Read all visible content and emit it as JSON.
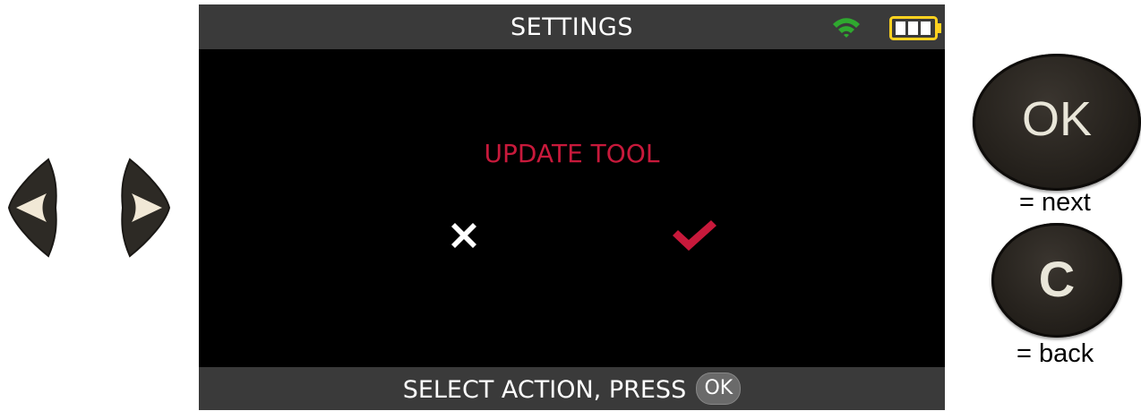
{
  "screen": {
    "title": "SETTINGS",
    "status_icons": [
      "wifi-icon",
      "battery-icon"
    ],
    "prompt": "UPDATE TOOL",
    "choices": [
      {
        "icon": "cross-icon",
        "state": "unselected",
        "color": "#ffffff"
      },
      {
        "icon": "check-icon",
        "state": "selected",
        "color": "#c8193b"
      }
    ],
    "footer_hint": "SELECT ACTION, PRESS",
    "footer_ok": "OK"
  },
  "keys": {
    "left_arrow": "arrow-left-key",
    "right_arrow": "arrow-right-key",
    "ok_label": "OK",
    "c_label": "C",
    "ok_legend": "= next",
    "c_legend": "= back"
  },
  "colors": {
    "accent": "#c8193b",
    "bar": "#3a3a3a",
    "screen_bg": "#000000",
    "wifi": "#2fa82f"
  }
}
